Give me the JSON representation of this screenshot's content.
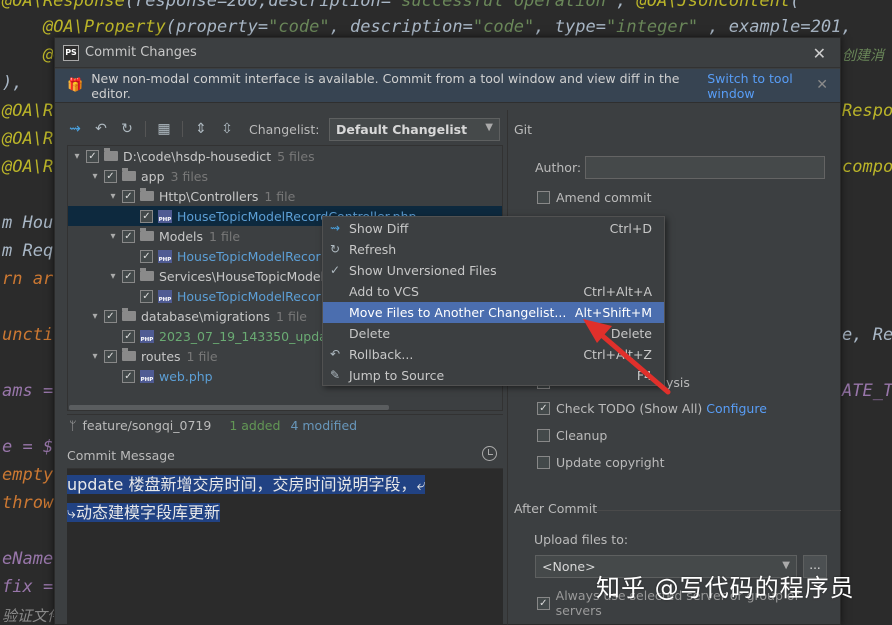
{
  "editor": {
    "lines": [
      "@OA\\Response(response=200,description=\"successful operation\", @OA\\JsonContent(",
      "    @OA\\Property(property=\"code\", description=\"code\", type=\"integer\" , example=201,",
      "    @OA",
      "),",
      "@OA\\Re",
      "@OA\\Re",
      "@OA\\Re",
      "m Hou",
      "m Req",
      "rn ar",
      "unctio",
      "ams =",
      "e = $",
      "empty",
      "throw",
      "eName",
      "fix =",
      "验证文件"
    ],
    "right_fragments": [
      "创建消",
      "Respo",
      "compo",
      "e, Re",
      "ATE_T"
    ]
  },
  "dialog": {
    "title": "Commit Changes",
    "logo": "PS",
    "banner": {
      "text": "New non-modal commit interface is available. Commit from a tool window and view diff in the editor.",
      "link": "Switch to tool window"
    },
    "changelist_label": "Changelist:",
    "changelist_value": "Default Changelist",
    "tree": [
      {
        "label": "D:\\code\\hsdp-housedict",
        "count": "5 files",
        "type": "dir"
      },
      {
        "label": "app",
        "count": "3 files",
        "type": "dir"
      },
      {
        "label": "Http\\Controllers",
        "count": "1 file",
        "type": "dir"
      },
      {
        "label": "HouseTopicModelRecordController.php",
        "count": "",
        "type": "file"
      },
      {
        "label": "Models",
        "count": "1 file",
        "type": "dir"
      },
      {
        "label": "HouseTopicModelRecor",
        "count": "",
        "type": "file"
      },
      {
        "label": "Services\\HouseTopicModel",
        "count": "",
        "type": "dir"
      },
      {
        "label": "HouseTopicModelRecor",
        "count": "",
        "type": "file"
      },
      {
        "label": "database\\migrations",
        "count": "1 file",
        "type": "dir"
      },
      {
        "label": "2023_07_19_143350_update",
        "count": "",
        "type": "new"
      },
      {
        "label": "routes",
        "count": "1 file",
        "type": "dir"
      },
      {
        "label": "web.php",
        "count": "",
        "type": "file"
      }
    ],
    "status": {
      "branch": "feature/songqi_0719",
      "added": "1 added",
      "modified": "4 modified"
    },
    "commit_message_label": "Commit Message",
    "commit_message_line1": "update 楼盘新增交房时间，交房时间说明字段，",
    "commit_message_line2": "动态建模字段库更新",
    "git_label": "Git",
    "author_label": "Author:",
    "amend_commit": "Amend commit",
    "partial_analysis": "ysis",
    "check_todo": "Check TODO (Show All)",
    "configure": "Configure",
    "cleanup": "Cleanup",
    "update_copyright": "Update copyright",
    "after_commit": "After Commit",
    "upload_label": "Upload files to:",
    "upload_value": "<None>",
    "more_button": "...",
    "always_use": "Always use selected server or group of servers"
  },
  "context_menu": {
    "items": [
      {
        "label": "Show Diff",
        "shortcut": "Ctrl+D",
        "icon": "diff-icon"
      },
      {
        "label": "Refresh",
        "shortcut": "",
        "icon": "refresh-icon"
      },
      {
        "label": "Show Unversioned Files",
        "shortcut": "",
        "icon": "check-icon"
      },
      {
        "label": "Add to VCS",
        "shortcut": "Ctrl+Alt+A",
        "icon": ""
      },
      {
        "label": "Move Files to Another Changelist...",
        "shortcut": "Alt+Shift+M",
        "icon": ""
      },
      {
        "label": "Delete",
        "shortcut": "Delete",
        "icon": ""
      },
      {
        "label": "Rollback...",
        "shortcut": "Ctrl+Alt+Z",
        "icon": "rollback-icon"
      },
      {
        "label": "Jump to Source",
        "shortcut": "F4",
        "icon": "jump-icon"
      }
    ]
  },
  "watermark": "知乎 @写代码的程序员",
  "colors": {
    "accent": "#4b6eaf",
    "selection": "#214283",
    "link": "#589df6",
    "arrow": "#e0302b"
  }
}
